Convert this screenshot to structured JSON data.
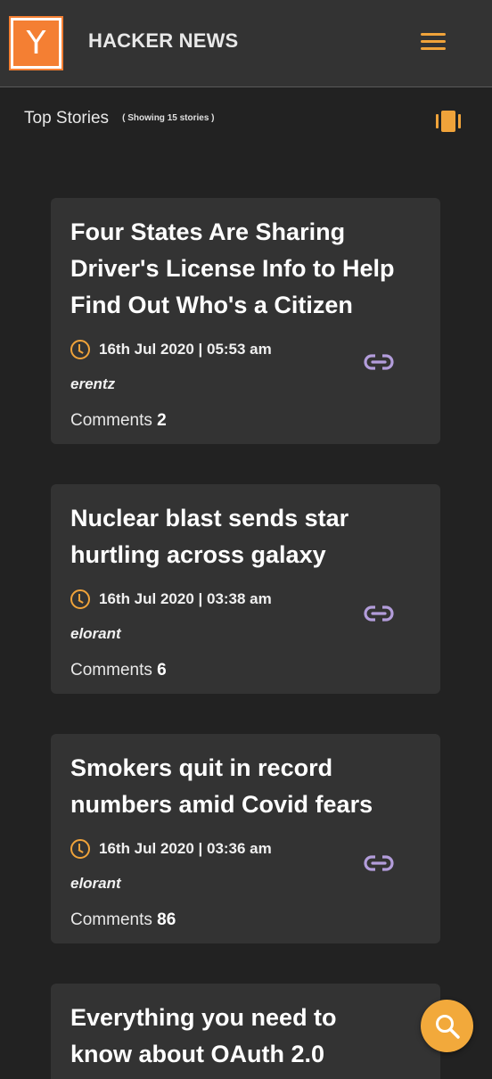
{
  "header": {
    "logo_letter": "Y",
    "title": "HACKER NEWS"
  },
  "section": {
    "title": "Top Stories",
    "count_text": "( Showing 15 stories )"
  },
  "stories": [
    {
      "title": "Four States Are Sharing Driver's License Info to Help Find Out Who's a Citizen",
      "time": "16th Jul 2020 | 05:53 am",
      "author": "erentz",
      "comments_label": "Comments",
      "comments_count": "2"
    },
    {
      "title": "Nuclear blast sends star hurtling across galaxy",
      "time": "16th Jul 2020 | 03:38 am",
      "author": "elorant",
      "comments_label": "Comments",
      "comments_count": "6"
    },
    {
      "title": "Smokers quit in record numbers amid Covid fears",
      "time": "16th Jul 2020 | 03:36 am",
      "author": "elorant",
      "comments_label": "Comments",
      "comments_count": "86"
    },
    {
      "title": "Everything you need to know about OAuth 2.0"
    }
  ],
  "colors": {
    "accent": "#f0a33a",
    "logo_bg": "#f47f33",
    "link_icon": "#b39ddb",
    "card_bg": "#333333",
    "page_bg": "#222222"
  },
  "icons": {
    "menu": "hamburger-icon",
    "layout": "card-view-icon",
    "time": "clock-icon",
    "link": "link-icon",
    "search": "search-icon"
  }
}
